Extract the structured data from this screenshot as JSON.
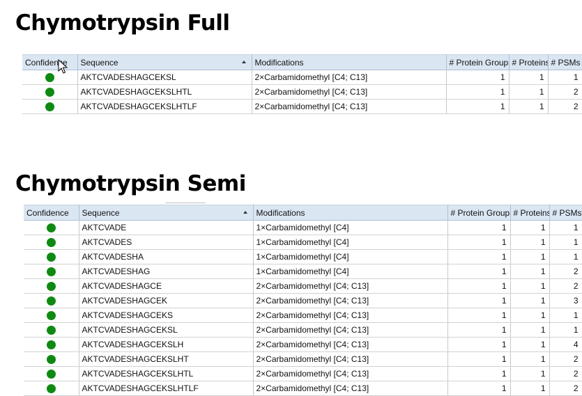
{
  "full": {
    "title": "Chymotrypsin Full",
    "columns": [
      "Confidence",
      "Sequence",
      "Modifications",
      "# Protein Groups",
      "# Proteins",
      "# PSMs"
    ],
    "rows": [
      {
        "sequence": "AKTCVADESHAGCEKSL",
        "modifications": "2×Carbamidomethyl [C4; C13]",
        "protein_groups": "1",
        "proteins": "1",
        "psms": "1"
      },
      {
        "sequence": "AKTCVADESHAGCEKSLHTL",
        "modifications": "2×Carbamidomethyl [C4; C13]",
        "protein_groups": "1",
        "proteins": "1",
        "psms": "2"
      },
      {
        "sequence": "AKTCVADESHAGCEKSLHTLF",
        "modifications": "2×Carbamidomethyl [C4; C13]",
        "protein_groups": "1",
        "proteins": "1",
        "psms": "2"
      }
    ]
  },
  "semi": {
    "title": "Chymotrypsin Semi",
    "columns": [
      "Confidence",
      "Sequence",
      "Modifications",
      "# Protein Groups",
      "# Proteins",
      "# PSMs"
    ],
    "rows": [
      {
        "sequence": "AKTCVADE",
        "modifications": "1×Carbamidomethyl [C4]",
        "protein_groups": "1",
        "proteins": "1",
        "psms": "1"
      },
      {
        "sequence": "AKTCVADES",
        "modifications": "1×Carbamidomethyl [C4]",
        "protein_groups": "1",
        "proteins": "1",
        "psms": "1"
      },
      {
        "sequence": "AKTCVADESHA",
        "modifications": "1×Carbamidomethyl [C4]",
        "protein_groups": "1",
        "proteins": "1",
        "psms": "1"
      },
      {
        "sequence": "AKTCVADESHAG",
        "modifications": "1×Carbamidomethyl [C4]",
        "protein_groups": "1",
        "proteins": "1",
        "psms": "2"
      },
      {
        "sequence": "AKTCVADESHAGCE",
        "modifications": "2×Carbamidomethyl [C4; C13]",
        "protein_groups": "1",
        "proteins": "1",
        "psms": "2"
      },
      {
        "sequence": "AKTCVADESHAGCEK",
        "modifications": "2×Carbamidomethyl [C4; C13]",
        "protein_groups": "1",
        "proteins": "1",
        "psms": "3"
      },
      {
        "sequence": "AKTCVADESHAGCEKS",
        "modifications": "2×Carbamidomethyl [C4; C13]",
        "protein_groups": "1",
        "proteins": "1",
        "psms": "1"
      },
      {
        "sequence": "AKTCVADESHAGCEKSL",
        "modifications": "2×Carbamidomethyl [C4; C13]",
        "protein_groups": "1",
        "proteins": "1",
        "psms": "1"
      },
      {
        "sequence": "AKTCVADESHAGCEKSLH",
        "modifications": "2×Carbamidomethyl [C4; C13]",
        "protein_groups": "1",
        "proteins": "1",
        "psms": "4"
      },
      {
        "sequence": "AKTCVADESHAGCEKSLHT",
        "modifications": "2×Carbamidomethyl [C4; C13]",
        "protein_groups": "1",
        "proteins": "1",
        "psms": "2"
      },
      {
        "sequence": "AKTCVADESHAGCEKSLHTL",
        "modifications": "2×Carbamidomethyl [C4; C13]",
        "protein_groups": "1",
        "proteins": "1",
        "psms": "2"
      },
      {
        "sequence": "AKTCVADESHAGCEKSLHTLF",
        "modifications": "2×Carbamidomethyl [C4; C13]",
        "protein_groups": "1",
        "proteins": "1",
        "psms": "2"
      }
    ]
  },
  "colors": {
    "confidence_high": "#0e8a12",
    "header_bg": "#dbe6f3"
  },
  "icons": {
    "confidence": "green-dot-icon",
    "sort": "sort-ascending-icon",
    "cursor": "mouse-pointer-icon"
  }
}
